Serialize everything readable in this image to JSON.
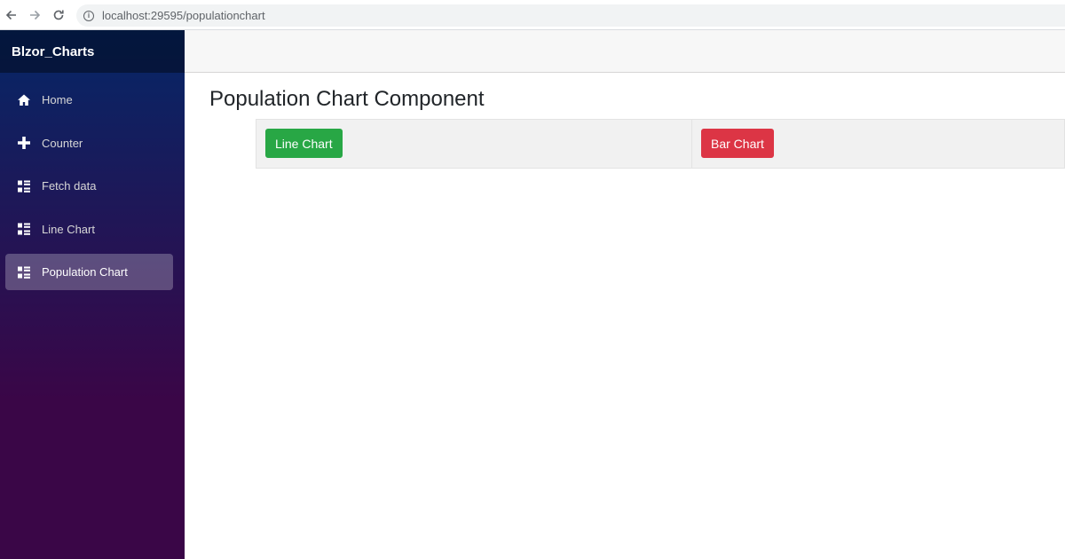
{
  "browser": {
    "url": "localhost:29595/populationchart"
  },
  "sidebar": {
    "brand": "Blzor_Charts",
    "items": [
      {
        "label": "Home",
        "icon": "home-icon",
        "active": false
      },
      {
        "label": "Counter",
        "icon": "plus-icon",
        "active": false
      },
      {
        "label": "Fetch data",
        "icon": "list-rich-icon",
        "active": false
      },
      {
        "label": "Line Chart",
        "icon": "list-rich-icon",
        "active": false
      },
      {
        "label": "Population Chart",
        "icon": "list-rich-icon",
        "active": true
      }
    ]
  },
  "main": {
    "title": "Population Chart Component",
    "buttons": {
      "line_chart": "Line Chart",
      "bar_chart": "Bar Chart"
    }
  },
  "colors": {
    "success": "#28a745",
    "danger": "#dc3545",
    "sidebar_top": "#052767",
    "sidebar_bottom": "#3a0647"
  }
}
